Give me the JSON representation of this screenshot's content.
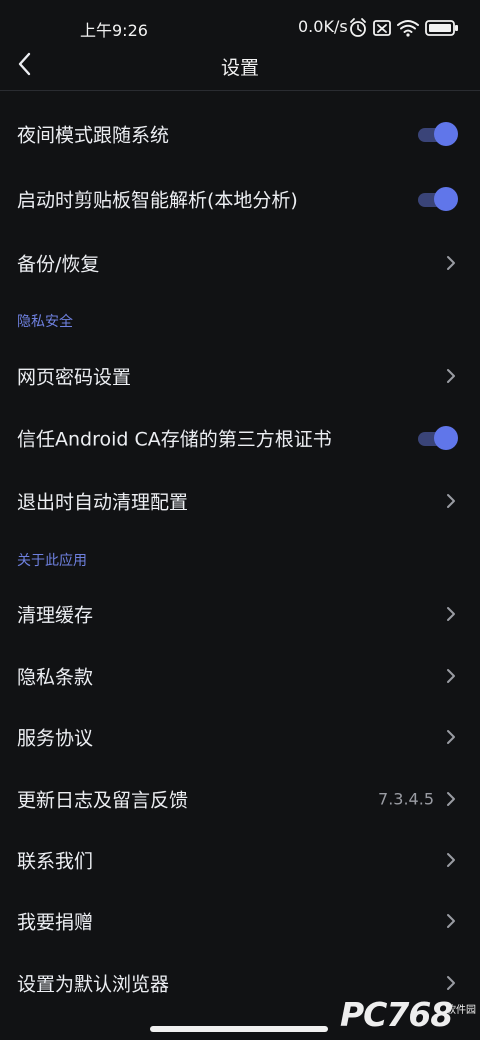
{
  "status_bar": {
    "time": "上午9:26",
    "network_speed": "0.0K/s",
    "icons": [
      "alarm-icon",
      "sim-disabled-icon",
      "wifi-icon",
      "battery-icon"
    ]
  },
  "header": {
    "title": "设置",
    "back_icon": "chevron-left-icon"
  },
  "general": [
    {
      "label": "夜间模式跟随系统",
      "type": "toggle",
      "on": true
    },
    {
      "label": "启动时剪贴板智能解析(本地分析)",
      "type": "toggle",
      "on": true
    },
    {
      "label": "备份/恢复",
      "type": "link"
    }
  ],
  "privacy_section": {
    "title": "隐私安全",
    "items": [
      {
        "label": "网页密码设置",
        "type": "link"
      },
      {
        "label": "信任Android CA存储的第三方根证书",
        "type": "toggle",
        "on": true
      },
      {
        "label": "退出时自动清理配置",
        "type": "link"
      }
    ]
  },
  "about_section": {
    "title": "关于此应用",
    "items": [
      {
        "label": "清理缓存",
        "type": "link"
      },
      {
        "label": "隐私条款",
        "type": "link"
      },
      {
        "label": "服务协议",
        "type": "link"
      },
      {
        "label": "更新日志及留言反馈",
        "type": "link",
        "value": "7.3.4.5"
      },
      {
        "label": "联系我们",
        "type": "link"
      },
      {
        "label": "我要捐赠",
        "type": "link"
      },
      {
        "label": "设置为默认浏览器",
        "type": "link"
      }
    ]
  },
  "watermark": {
    "text": "PC768",
    "badge": "软件园"
  },
  "colors": {
    "background": "#111214",
    "accent": "#6076ea",
    "toggle_track": "#3a4478",
    "section_text": "#6e80de",
    "secondary_text": "#9a9ca3"
  }
}
